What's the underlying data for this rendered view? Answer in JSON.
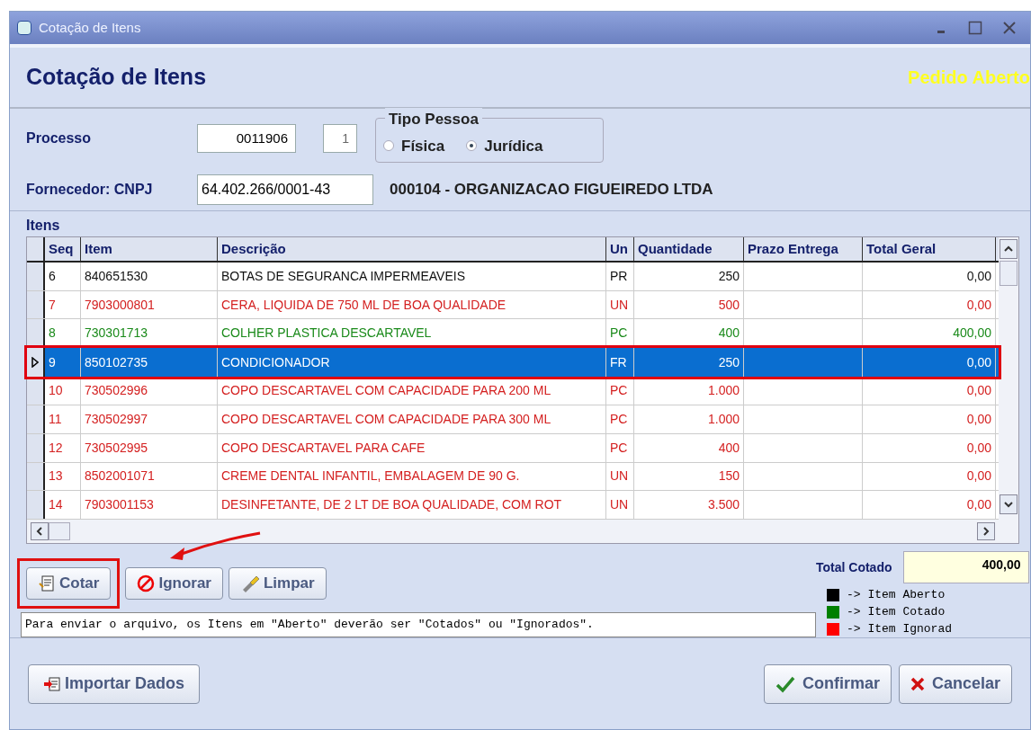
{
  "window": {
    "title": "Cotação de Itens"
  },
  "header": {
    "title": "Cotação de Itens",
    "status": "Pedido Aberto"
  },
  "form": {
    "processo_label": "Processo",
    "processo": "0011906",
    "processo_seq": "1",
    "tipo_pessoa": {
      "title": "Tipo Pessoa",
      "options": [
        {
          "label": "Física",
          "selected": false
        },
        {
          "label": "Jurídica",
          "selected": true
        }
      ]
    },
    "fornecedor_label": "Fornecedor: CNPJ",
    "cnpj": "64.402.266/0001-43",
    "fornecedor_name": "000104 - ORGANIZACAO FIGUEIREDO LTDA"
  },
  "table": {
    "title": "Itens",
    "columns": [
      "Seq",
      "Item",
      "Descrição",
      "Un",
      "Quantidade",
      "Prazo Entrega",
      "Total Geral"
    ],
    "rows": [
      {
        "color": "#111111",
        "selected": false,
        "cells": [
          "6",
          "840651530",
          "BOTAS DE SEGURANCA IMPERMEAVEIS",
          "PR",
          "250",
          "",
          "0,00"
        ]
      },
      {
        "color": "#d42020",
        "selected": false,
        "cells": [
          "7",
          "7903000801",
          "CERA, LIQUIDA DE 750 ML DE BOA QUALIDADE",
          "UN",
          "500",
          "",
          "0,00"
        ]
      },
      {
        "color": "#1a8a1a",
        "selected": false,
        "cells": [
          "8",
          "730301713",
          "COLHER PLASTICA DESCARTAVEL",
          "PC",
          "400",
          "",
          "400,00"
        ]
      },
      {
        "selected": true,
        "cells": [
          "9",
          "850102735",
          "CONDICIONADOR",
          "FR",
          "250",
          "",
          "0,00"
        ]
      },
      {
        "color": "#d42020",
        "selected": false,
        "cells": [
          "10",
          "730502996",
          "COPO DESCARTAVEL COM CAPACIDADE PARA 200 ML",
          "PC",
          "1.000",
          "",
          "0,00"
        ]
      },
      {
        "color": "#d42020",
        "selected": false,
        "cells": [
          "11",
          "730502997",
          "COPO DESCARTAVEL COM CAPACIDADE PARA 300 ML",
          "PC",
          "1.000",
          "",
          "0,00"
        ]
      },
      {
        "color": "#d42020",
        "selected": false,
        "cells": [
          "12",
          "730502995",
          "COPO DESCARTAVEL PARA CAFE",
          "PC",
          "400",
          "",
          "0,00"
        ]
      },
      {
        "color": "#d42020",
        "selected": false,
        "cells": [
          "13",
          "8502001071",
          "CREME DENTAL INFANTIL, EMBALAGEM DE 90 G.",
          "UN",
          "150",
          "",
          "0,00"
        ]
      },
      {
        "color": "#d42020",
        "selected": false,
        "cells": [
          "14",
          "7903001153",
          "DESINFETANTE, DE 2 LT DE BOA QUALIDADE, COM ROT",
          "UN",
          "3.500",
          "",
          "0,00"
        ]
      }
    ]
  },
  "actions": [
    {
      "kind": "quote",
      "label": "Cotar"
    },
    {
      "kind": "ignore",
      "label": "Ignorar"
    },
    {
      "kind": "clear",
      "label": "Limpar"
    }
  ],
  "total": {
    "label": "Total Cotado",
    "value": "400,00"
  },
  "message": "Para enviar o arquivo, os Itens em \"Aberto\" deverão ser \"Cotados\" ou \"Ignorados\".",
  "legend": [
    {
      "color": "#000000",
      "label": "-> Item Aberto"
    },
    {
      "color": "#008000",
      "label": "-> Item Cotado"
    },
    {
      "color": "#ff0000",
      "label": "-> Item Ignorad"
    }
  ],
  "footer": {
    "import": "Importar Dados",
    "confirm": "Confirmar",
    "cancel": "Cancelar"
  }
}
